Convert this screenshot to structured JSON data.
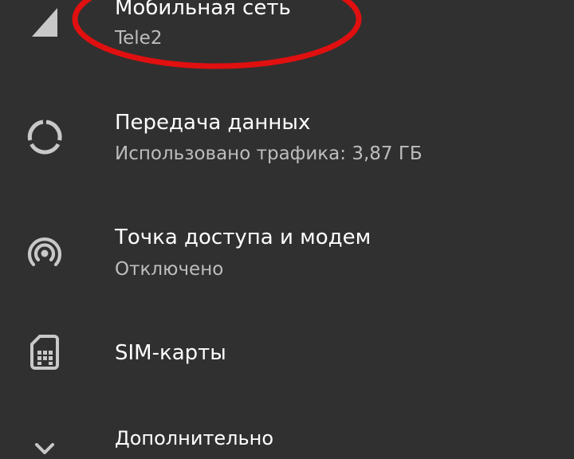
{
  "settings": {
    "items": [
      {
        "icon": "signal-icon",
        "title": "Мобильная сеть",
        "subtitle": "Tele2"
      },
      {
        "icon": "data-usage-icon",
        "title": "Передача данных",
        "subtitle": "Использовано трафика: 3,87 ГБ"
      },
      {
        "icon": "hotspot-icon",
        "title": "Точка доступа и модем",
        "subtitle": "Отключено"
      },
      {
        "icon": "sim-card-icon",
        "title": "SIM-карты"
      },
      {
        "icon": "chevron-down-icon",
        "title": "Дополнительно"
      }
    ]
  },
  "colors": {
    "background": "#303030",
    "text_primary": "#ffffff",
    "text_secondary": "#bdbdbd",
    "icon": "#c8c8c8",
    "highlight": "#e01010"
  }
}
